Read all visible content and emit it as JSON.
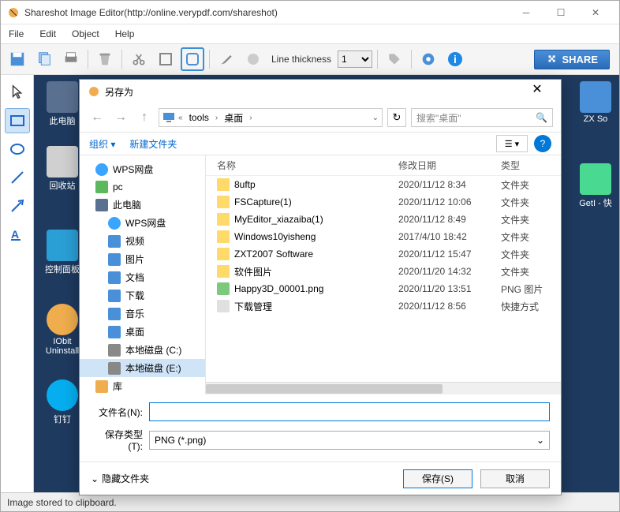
{
  "window": {
    "title": "Shareshot Image Editor(http://online.verypdf.com/shareshot)"
  },
  "menu": {
    "file": "File",
    "edit": "Edit",
    "object": "Object",
    "help": "Help"
  },
  "toolbar": {
    "thickness_label": "Line thickness",
    "thickness_value": "1",
    "share_label": "SHARE"
  },
  "status": "Image stored to clipboard.",
  "desktop": {
    "icons": [
      {
        "label": "此电脑"
      },
      {
        "label": "回收站"
      },
      {
        "label": "控制面板"
      },
      {
        "label": "IObit Uninstall"
      },
      {
        "label": "钉钉"
      },
      {
        "label": "ZX So"
      },
      {
        "label": "GetI - 快"
      }
    ]
  },
  "dialog": {
    "title": "另存为",
    "path": {
      "seg1": "tools",
      "seg2": "桌面"
    },
    "search_placeholder": "搜索\"桌面\"",
    "organize": "组织",
    "new_folder": "新建文件夹",
    "columns": {
      "name": "名称",
      "date": "修改日期",
      "type": "类型"
    },
    "tree": [
      {
        "label": "WPS网盘",
        "cls": "ico-cloud",
        "indent": "i1"
      },
      {
        "label": "pc",
        "cls": "ico-green",
        "indent": "i1"
      },
      {
        "label": "此电脑",
        "cls": "ico-pc",
        "indent": "i1"
      },
      {
        "label": "WPS网盘",
        "cls": "ico-cloud",
        "indent": "i2"
      },
      {
        "label": "视频",
        "cls": "ico-blue",
        "indent": "i2"
      },
      {
        "label": "图片",
        "cls": "ico-blue",
        "indent": "i2"
      },
      {
        "label": "文档",
        "cls": "ico-blue",
        "indent": "i2"
      },
      {
        "label": "下载",
        "cls": "ico-blue",
        "indent": "i2"
      },
      {
        "label": "音乐",
        "cls": "ico-blue",
        "indent": "i2"
      },
      {
        "label": "桌面",
        "cls": "ico-blue",
        "indent": "i2"
      },
      {
        "label": "本地磁盘 (C:)",
        "cls": "ico-disk",
        "indent": "i2"
      },
      {
        "label": "本地磁盘 (E:)",
        "cls": "ico-disk",
        "indent": "i2",
        "sel": true
      },
      {
        "label": "库",
        "cls": "ico-orange",
        "indent": "i1"
      }
    ],
    "files": [
      {
        "name": "8uftp",
        "date": "2020/11/12 8:34",
        "type": "文件夹",
        "cls": "ico-folder"
      },
      {
        "name": "FSCapture(1)",
        "date": "2020/11/12 10:06",
        "type": "文件夹",
        "cls": "ico-folder"
      },
      {
        "name": "MyEditor_xiazaiba(1)",
        "date": "2020/11/12 8:49",
        "type": "文件夹",
        "cls": "ico-folder"
      },
      {
        "name": "Windows10yisheng",
        "date": "2017/4/10 18:42",
        "type": "文件夹",
        "cls": "ico-folder"
      },
      {
        "name": "ZXT2007 Software",
        "date": "2020/11/12 15:47",
        "type": "文件夹",
        "cls": "ico-folder"
      },
      {
        "name": "软件图片",
        "date": "2020/11/20 14:32",
        "type": "文件夹",
        "cls": "ico-folder"
      },
      {
        "name": "Happy3D_00001.png",
        "date": "2020/11/20 13:51",
        "type": "PNG 图片",
        "cls": "ico-png"
      },
      {
        "name": "下载管理",
        "date": "2020/11/12 8:56",
        "type": "快捷方式",
        "cls": "ico-link"
      }
    ],
    "filename_label": "文件名(N):",
    "filetype_label": "保存类型(T):",
    "filetype_value": "PNG (*.png)",
    "hide_folders": "隐藏文件夹",
    "save": "保存(S)",
    "cancel": "取消"
  }
}
